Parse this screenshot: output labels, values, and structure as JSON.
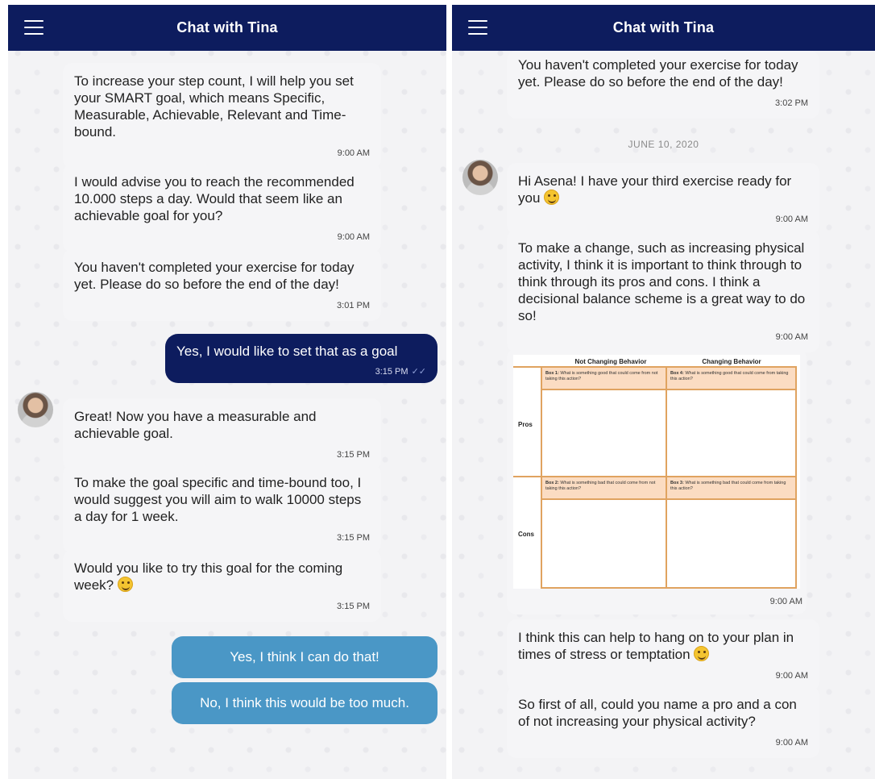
{
  "left_screen": {
    "header": {
      "title": "Chat with Tina"
    },
    "messages": [
      {
        "text": "To increase your step count, I will help you set your SMART goal, which means Specific, Measurable, Achievable, Relevant and Time-bound.",
        "time": "9:00 AM"
      },
      {
        "text": "I would advise you to reach the recommended 10.000 steps a day. Would that seem like an achievable goal for you?",
        "time": "9:00 AM"
      },
      {
        "text": "You haven't completed your exercise for today yet. Please do so before the end of the day!",
        "time": "3:01 PM"
      },
      {
        "text": "Great! Now you have a measurable and achievable goal.",
        "time": "3:15 PM"
      },
      {
        "text": "To make the goal specific and time-bound too, I would suggest you will aim to walk 10000 steps a day for 1 week.",
        "time": "3:15 PM"
      },
      {
        "text": "Would you like to try this goal for the coming week?",
        "time": "3:15 PM"
      }
    ],
    "user_message": {
      "text": "Yes, I would like to set that as a goal",
      "time": "3:15 PM"
    },
    "options": [
      "Yes, I think I can do that!",
      "No, I think this would be too much."
    ]
  },
  "right_screen": {
    "header": {
      "title": "Chat with Tina"
    },
    "date_separator": "JUNE 10, 2020",
    "messages": [
      {
        "text": "You haven't completed your exercise for today yet. Please do so before the end of the day!",
        "time": "3:02 PM"
      },
      {
        "text": "Hi Asena! I have your third exercise ready for you",
        "time": "9:00 AM"
      },
      {
        "text": "To make a change, such as increasing physical activity, I think it is important to think through to think through its pros and cons. I think a decisional balance scheme is a great way to do so!",
        "time": "9:00 AM"
      },
      {
        "text": "I think this can help to hang on to your plan in times of stress or temptation",
        "time": "9:00 AM"
      },
      {
        "text": "So first of all, could you name a pro and a con of not increasing your physical activity?",
        "time": "9:00 AM"
      }
    ],
    "scheme": {
      "col_not_changing": "Not Changing Behavior",
      "col_changing": "Changing Behavior",
      "row_pros": "Pros",
      "row_cons": "Cons",
      "box1_label": "Box 1:",
      "box1_text": "What is something good that could come from not taking this action?",
      "box4_label": "Box 4:",
      "box4_text": "What is something good that could come from taking this action?",
      "box2_label": "Box 2:",
      "box2_text": "What is something bad that could come from not taking this action?",
      "box3_label": "Box 3:",
      "box3_text": "What is something bad that could come from taking this action?",
      "time": "9:00 AM"
    }
  },
  "icons": {
    "menu": "hamburger-menu-icon",
    "read_receipt": "double-check-icon",
    "emoji_grin": "grinning-emoji-icon",
    "emoji_wink": "winking-emoji-icon",
    "emoji_smile": "smiling-emoji-icon"
  },
  "colors": {
    "header": "#0d1c5e",
    "user_bubble": "#0d1c5e",
    "option_button": "#4a97c6",
    "bot_bubble": "#f5f5f7",
    "scheme_accent": "#e0a360",
    "scheme_header": "#fbdcc2"
  }
}
